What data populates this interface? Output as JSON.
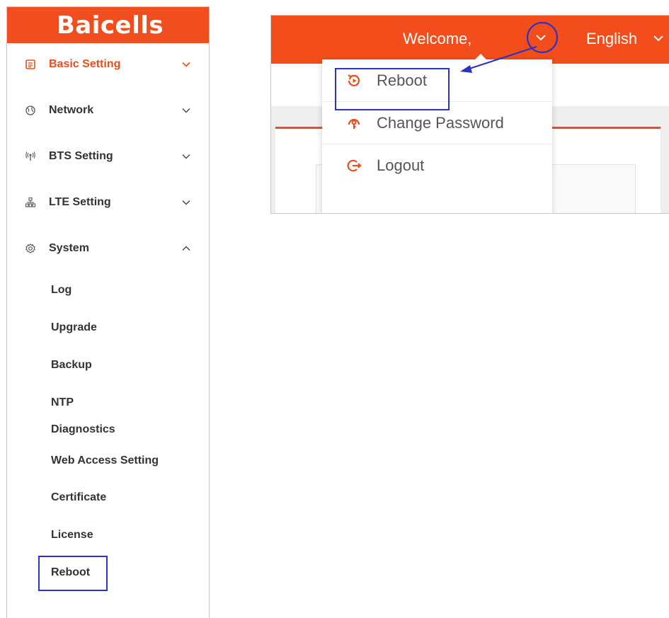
{
  "brand": {
    "logo_text": "Baicells",
    "accent_color": "#f04e1e",
    "annotation_color": "#2a33c4"
  },
  "sidebar": {
    "items": [
      {
        "label": "Basic Setting",
        "icon": "basic-setting-icon",
        "active": true,
        "expanded": false
      },
      {
        "label": "Network",
        "icon": "globe-icon",
        "active": false,
        "expanded": false
      },
      {
        "label": "BTS Setting",
        "icon": "antenna-icon",
        "active": false,
        "expanded": false
      },
      {
        "label": "LTE Setting",
        "icon": "network-tree-icon",
        "active": false,
        "expanded": false
      },
      {
        "label": "System",
        "icon": "gear-icon",
        "active": false,
        "expanded": true
      }
    ],
    "system_subitems": [
      "Log",
      "Upgrade",
      "Backup",
      "NTP",
      "Diagnostics",
      "Web Access Setting",
      "Certificate",
      "License",
      "Reboot"
    ]
  },
  "header": {
    "welcome": "Welcome,",
    "language": "English"
  },
  "user_menu": {
    "items": [
      {
        "label": "Reboot",
        "icon": "reboot-icon"
      },
      {
        "label": "Change Password",
        "icon": "key-icon"
      },
      {
        "label": "Logout",
        "icon": "logout-icon"
      }
    ]
  }
}
